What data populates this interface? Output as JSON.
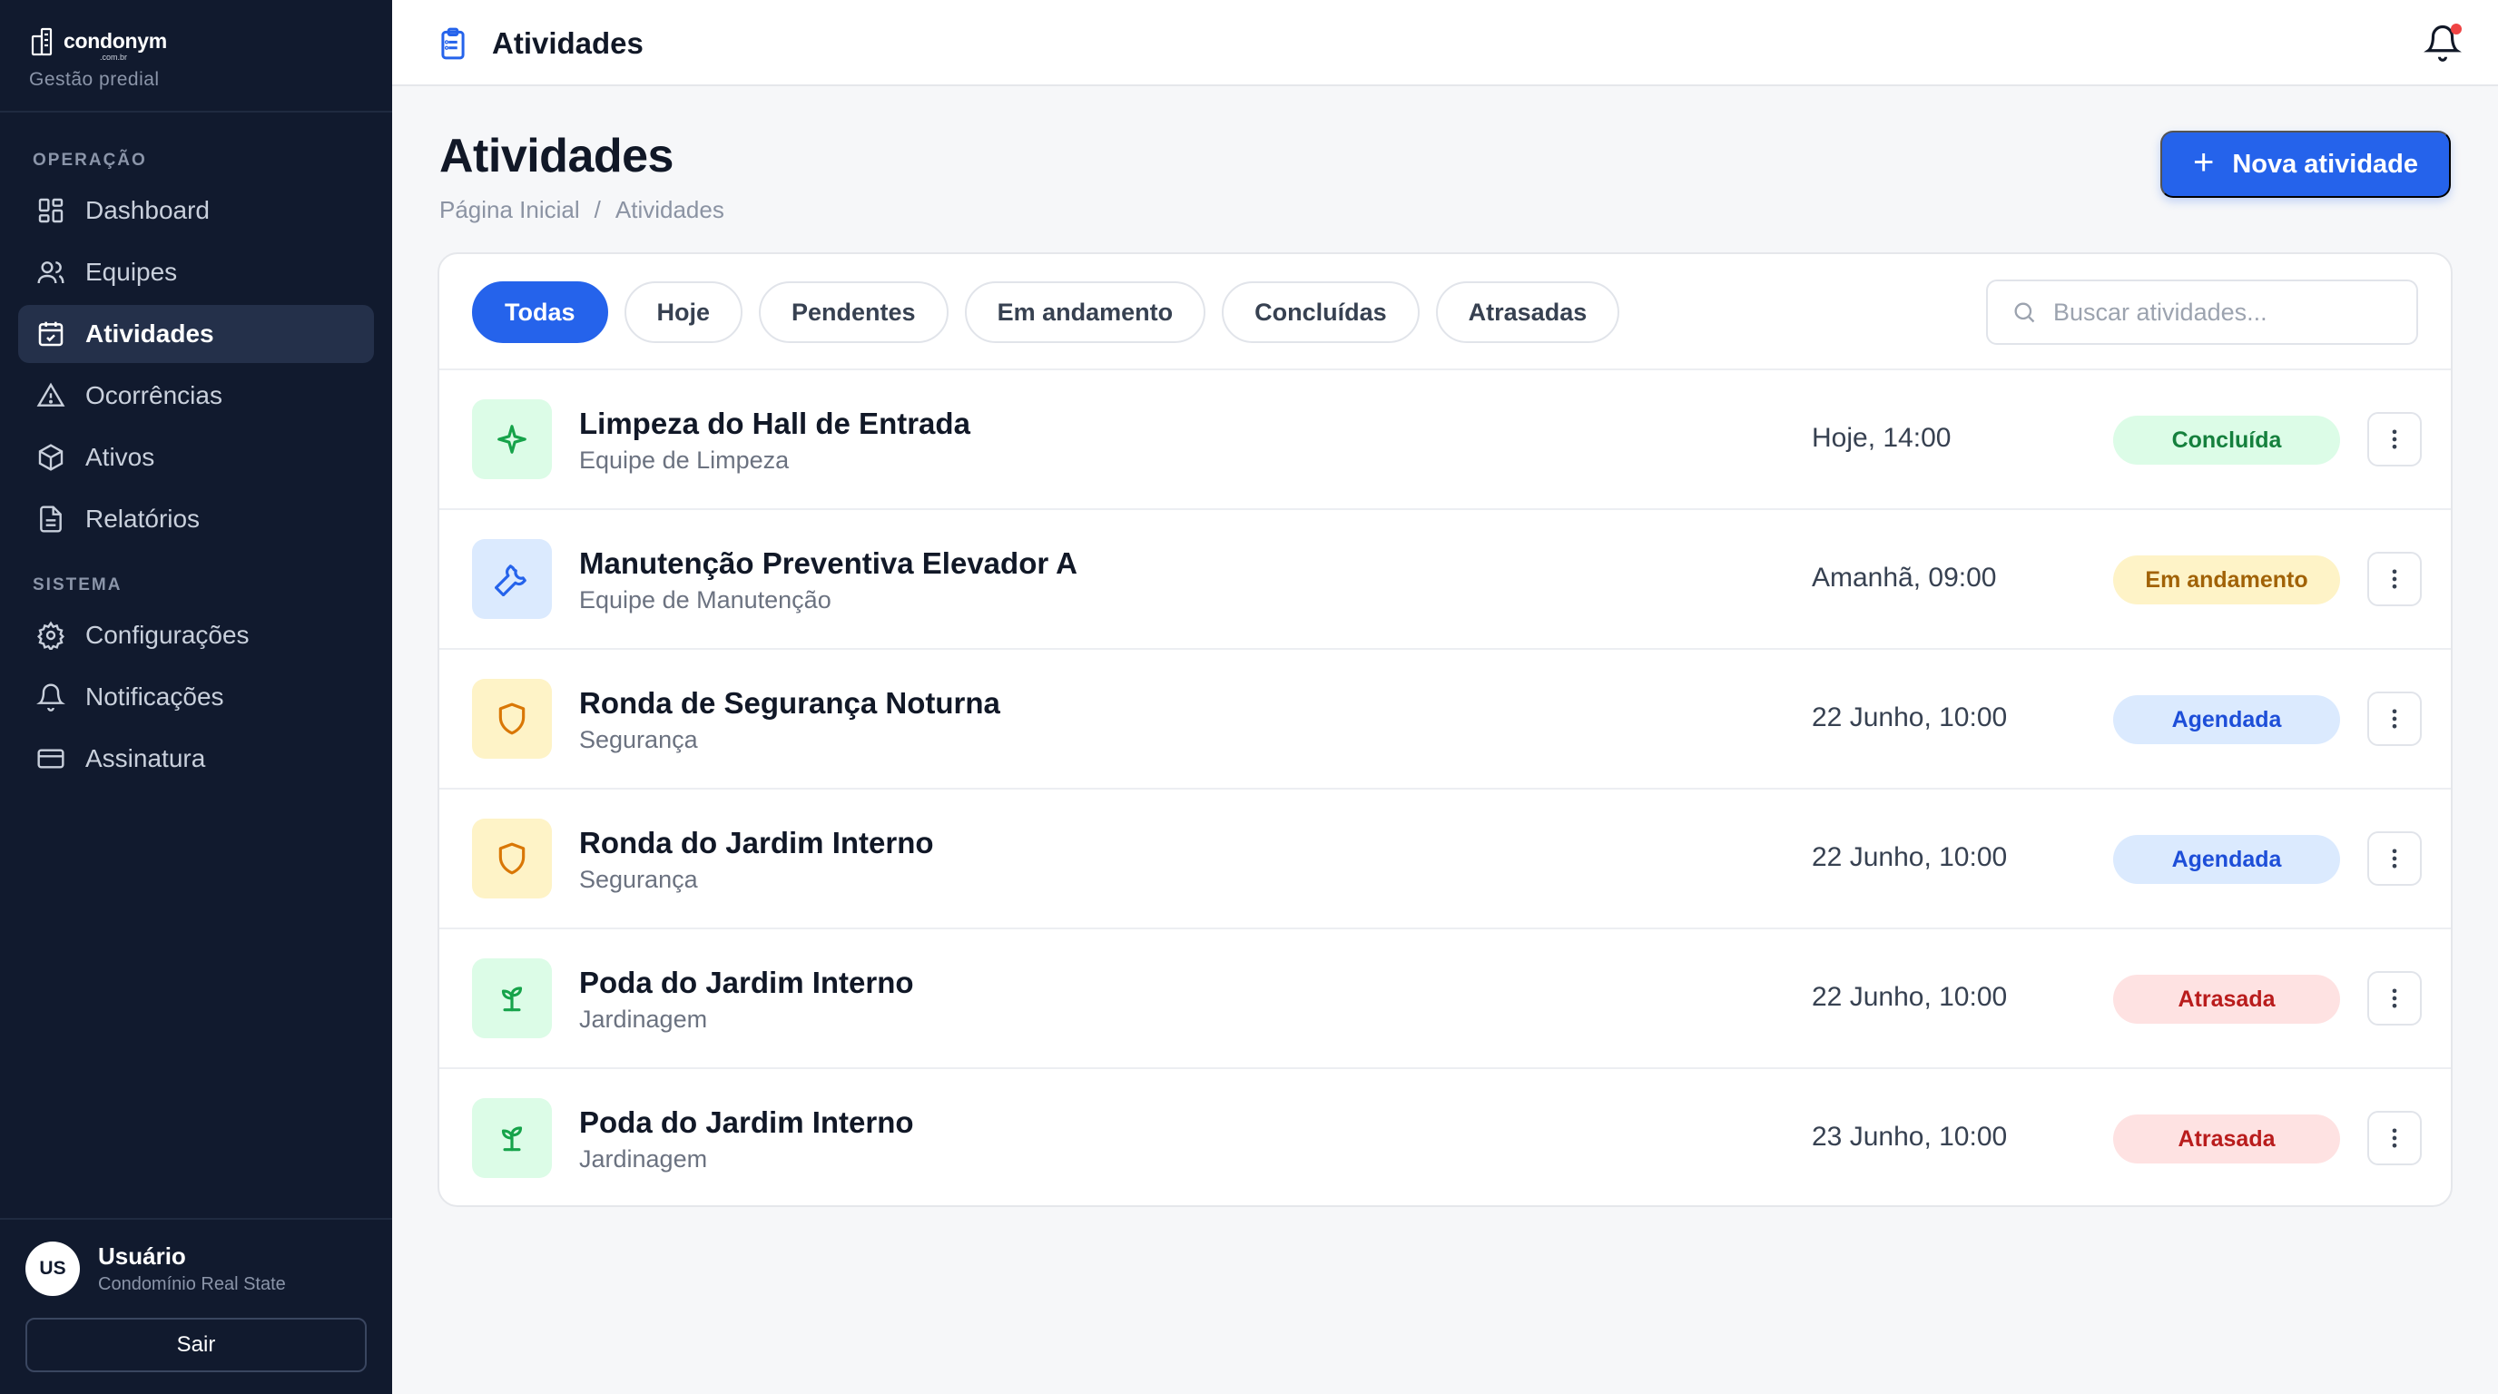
{
  "brand": {
    "name": "condonym",
    "tld": ".com.br",
    "subtitle": "Gestão predial"
  },
  "sidebar": {
    "section_operation": "OPERAÇÃO",
    "section_system": "SISTEMA",
    "items": [
      {
        "label": "Dashboard",
        "icon": "dashboard-icon"
      },
      {
        "label": "Equipes",
        "icon": "users-icon"
      },
      {
        "label": "Atividades",
        "icon": "calendar-check-icon",
        "active": true
      },
      {
        "label": "Ocorrências",
        "icon": "alert-triangle-icon"
      },
      {
        "label": "Ativos",
        "icon": "box-icon"
      },
      {
        "label": "Relatórios",
        "icon": "file-text-icon"
      },
      {
        "label": "Configurações",
        "icon": "gear-icon"
      },
      {
        "label": "Notificações",
        "icon": "bell-icon"
      },
      {
        "label": "Assinatura",
        "icon": "credit-card-icon"
      }
    ]
  },
  "user": {
    "initials": "US",
    "name": "Usuário",
    "org": "Condomínio Real State",
    "logout_label": "Sair"
  },
  "topbar": {
    "title": "Atividades",
    "has_notification": true
  },
  "page": {
    "title": "Atividades",
    "breadcrumb": [
      "Página Inicial",
      "/",
      "Atividades"
    ],
    "new_button": "Nova atividade"
  },
  "filters": [
    "Todas",
    "Hoje",
    "Pendentes",
    "Em andamento",
    "Concluídas",
    "Atrasadas"
  ],
  "active_filter": "Todas",
  "search": {
    "placeholder": "Buscar atividades...",
    "value": ""
  },
  "colors": {
    "primary": "#2563eb",
    "sidebar_bg": "#111a2e",
    "green_bg": "#dcfce7",
    "green_fg": "#15803d",
    "blue_bg": "#dbeafe",
    "blue_fg": "#1d4ed8",
    "amber_bg": "#fef3c7",
    "amber_fg": "#b45309",
    "red_bg": "#fee2e2",
    "red_fg": "#b91c1c"
  },
  "activities": [
    {
      "title": "Limpeza do Hall de Entrada",
      "team": "Equipe de Limpeza",
      "date": "Hoje, 14:00",
      "status": "Concluída",
      "status_kind": "done",
      "icon": "sparkle-icon",
      "icon_kind": "green"
    },
    {
      "title": "Manutenção Preventiva Elevador A",
      "team": "Equipe de Manutenção",
      "date": "Amanhã, 09:00",
      "status": "Em andamento",
      "status_kind": "progress",
      "icon": "wrench-icon",
      "icon_kind": "blue"
    },
    {
      "title": "Ronda de Segurança Noturna",
      "team": "Segurança",
      "date": "22 Junho, 10:00",
      "status": "Agendada",
      "status_kind": "scheduled",
      "icon": "shield-icon",
      "icon_kind": "amber"
    },
    {
      "title": "Ronda do Jardim Interno",
      "team": "Segurança",
      "date": "22 Junho, 10:00",
      "status": "Agendada",
      "status_kind": "scheduled",
      "icon": "shield-icon",
      "icon_kind": "amber"
    },
    {
      "title": "Poda do Jardim Interno",
      "team": "Jardinagem",
      "date": "22 Junho, 10:00",
      "status": "Atrasada",
      "status_kind": "late",
      "icon": "sprout-icon",
      "icon_kind": "green"
    },
    {
      "title": "Poda do Jardim Interno",
      "team": "Jardinagem",
      "date": "23 Junho, 10:00",
      "status": "Atrasada",
      "status_kind": "late",
      "icon": "sprout-icon",
      "icon_kind": "green"
    }
  ]
}
